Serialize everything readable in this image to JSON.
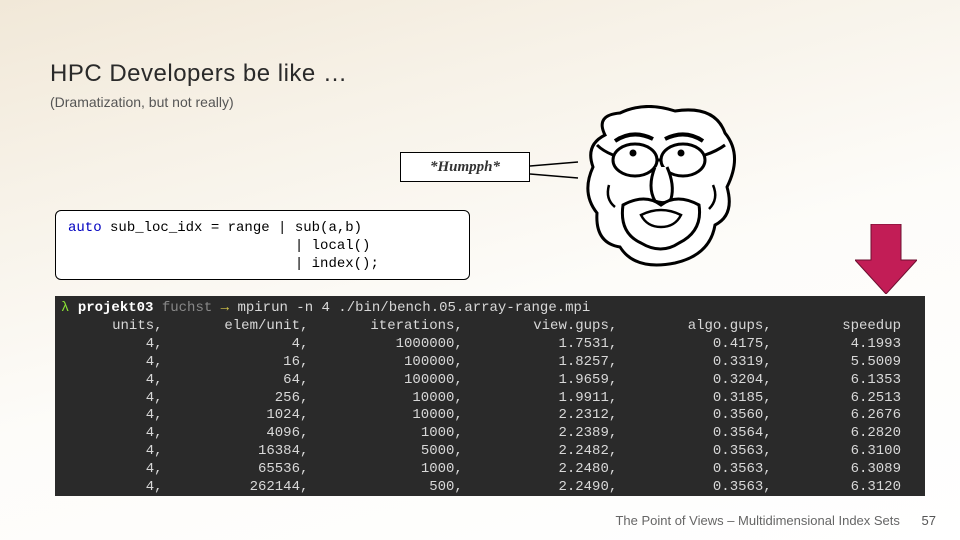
{
  "title": "HPC Developers be like …",
  "subtitle": "(Dramatization, but not really)",
  "speech": "*Humpph*",
  "code": {
    "keyword": "auto",
    "line1_rest": " sub_loc_idx = range | sub(a,b)",
    "line2": "                           | local()",
    "line3": "                           | index();"
  },
  "terminal": {
    "lambda": "λ",
    "host": "projekt03",
    "dir": "fuchst",
    "arrow": "→",
    "cmd": " mpirun -n 4 ./bin/bench.05.array-range.mpi",
    "headers": [
      "units,",
      "elem/unit,",
      "iterations,",
      "view.gups,",
      "algo.gups,",
      "speedup"
    ],
    "rows": [
      [
        "4,",
        "4,",
        "1000000,",
        "1.7531,",
        "0.4175,",
        "4.1993"
      ],
      [
        "4,",
        "16,",
        "100000,",
        "1.8257,",
        "0.3319,",
        "5.5009"
      ],
      [
        "4,",
        "64,",
        "100000,",
        "1.9659,",
        "0.3204,",
        "6.1353"
      ],
      [
        "4,",
        "256,",
        "10000,",
        "1.9911,",
        "0.3185,",
        "6.2513"
      ],
      [
        "4,",
        "1024,",
        "10000,",
        "2.2312,",
        "0.3560,",
        "6.2676"
      ],
      [
        "4,",
        "4096,",
        "1000,",
        "2.2389,",
        "0.3564,",
        "6.2820"
      ],
      [
        "4,",
        "16384,",
        "5000,",
        "2.2482,",
        "0.3563,",
        "6.3100"
      ],
      [
        "4,",
        "65536,",
        "1000,",
        "2.2480,",
        "0.3563,",
        "6.3089"
      ],
      [
        "4,",
        "262144,",
        "500,",
        "2.2490,",
        "0.3563,",
        "6.3120"
      ]
    ]
  },
  "footer": "The Point of Views – Multidimensional Index Sets",
  "page": "57",
  "colors": {
    "arrow": "#c21d56"
  }
}
